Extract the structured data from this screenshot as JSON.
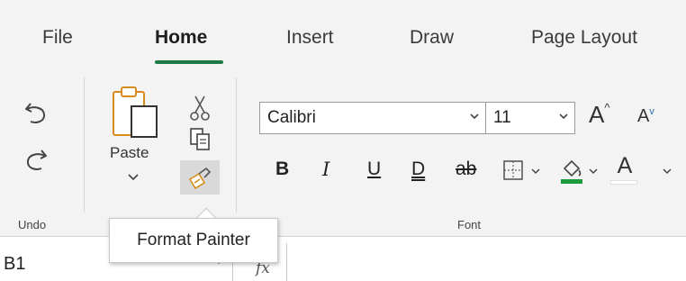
{
  "tabs": {
    "file": "File",
    "home": "Home",
    "insert": "Insert",
    "draw": "Draw",
    "page_layout": "Page Layout"
  },
  "ribbon": {
    "undo_group": {
      "label": "Undo",
      "undo_icon": "undo-icon",
      "redo_icon": "redo-icon"
    },
    "clipboard_group": {
      "paste_label": "Paste",
      "cut_icon": "scissors-icon",
      "copy_icon": "copy-icon",
      "format_painter_icon": "paintbrush-icon"
    },
    "font_group": {
      "label": "Font",
      "font_name": "Calibri",
      "font_size": "11",
      "bold": "B",
      "italic": "I",
      "underline": "U",
      "double_underline": "D",
      "strikethrough": "ab",
      "font_color_letter": "A",
      "increase_size": "A",
      "decrease_size": "A",
      "fill_color": "#1d9a3c",
      "font_color": "#ffffff"
    }
  },
  "tooltip": {
    "text": "Format Painter"
  },
  "formula_bar": {
    "name_box": "B1",
    "fx_label": "fx"
  },
  "colors": {
    "accent": "#1d7a45"
  }
}
